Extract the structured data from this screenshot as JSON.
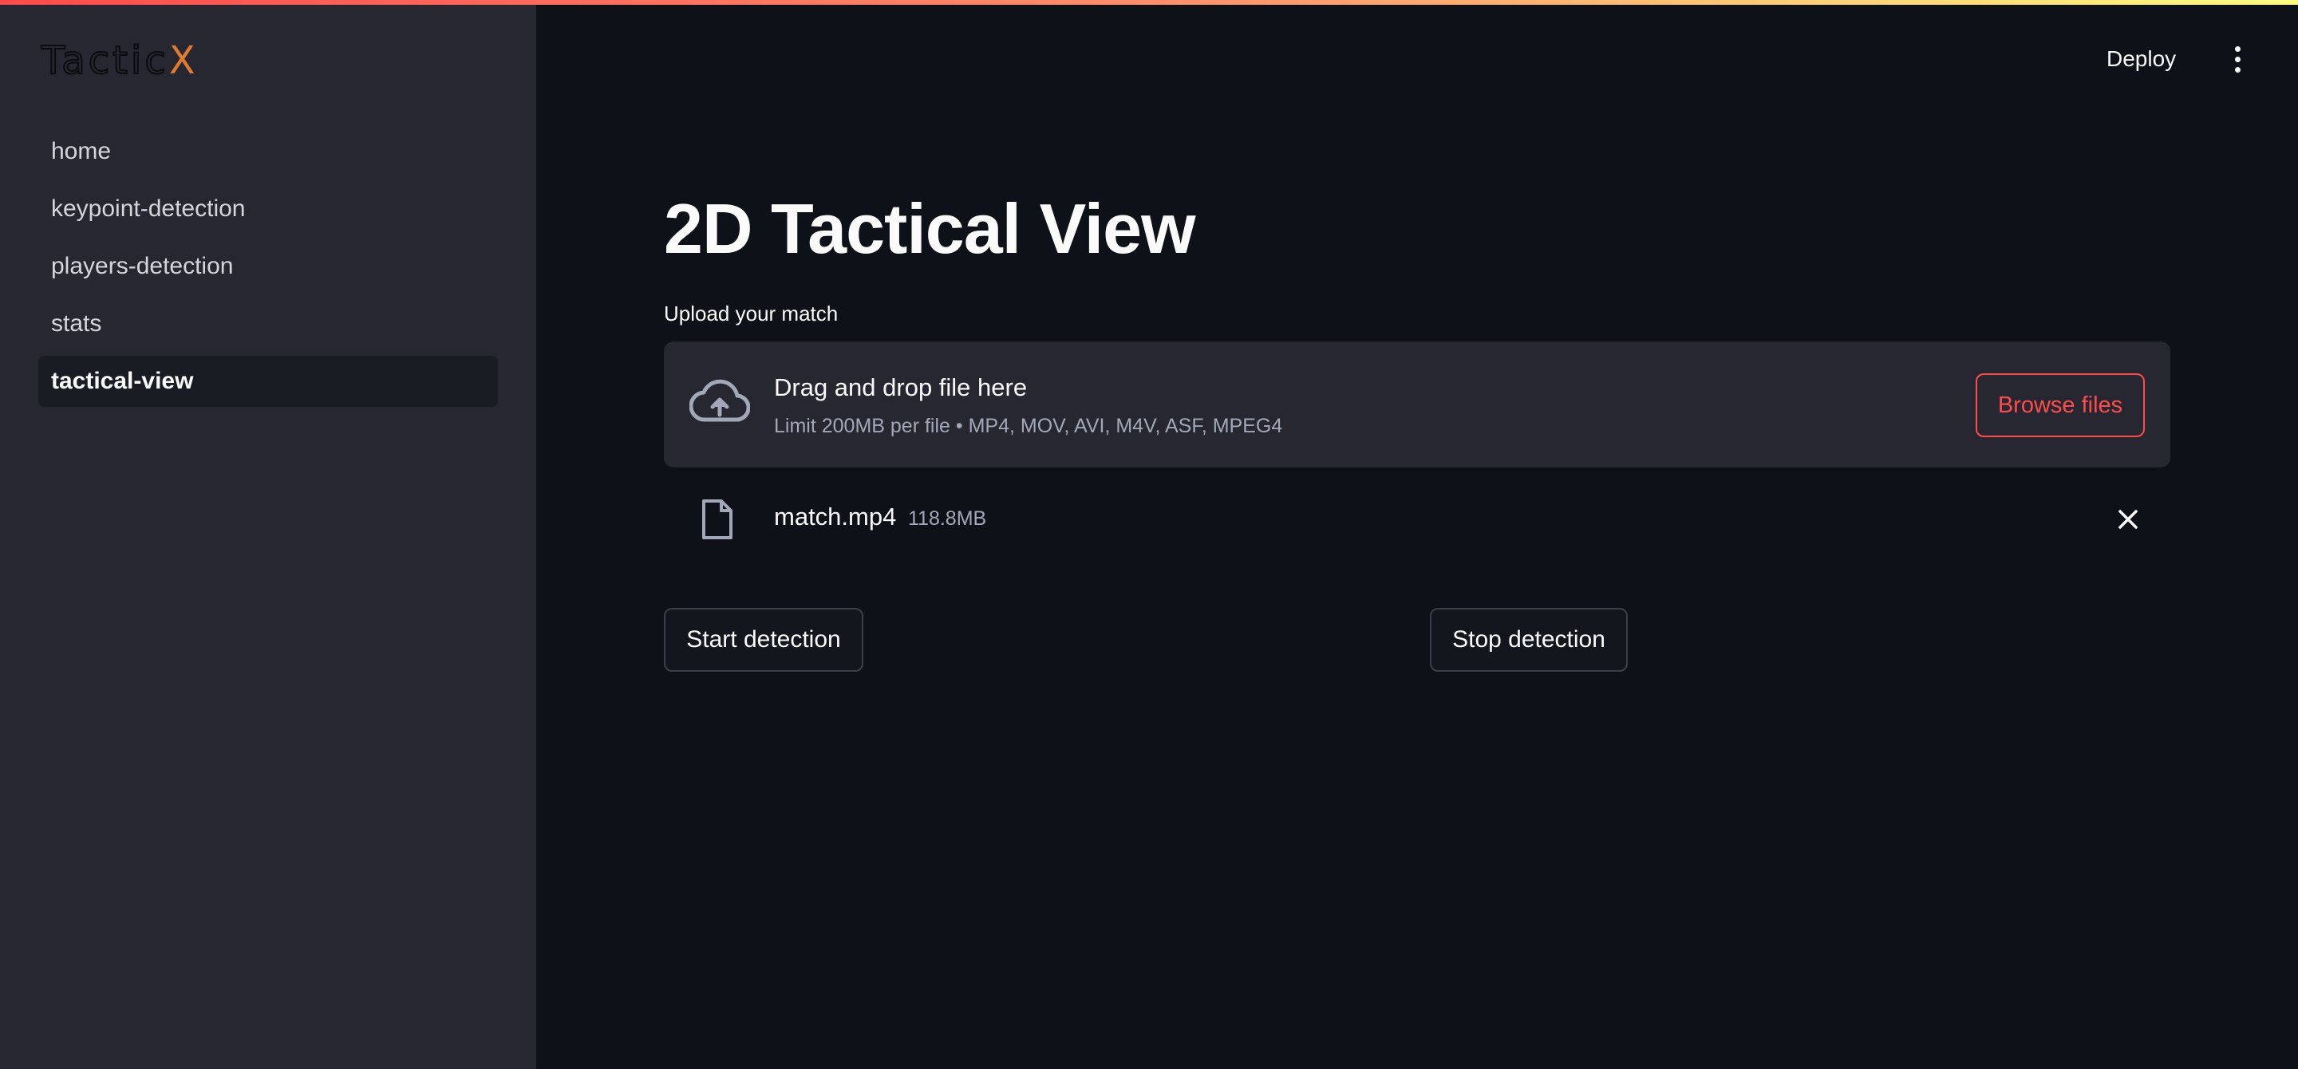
{
  "app": {
    "logo_main": "Tactic",
    "logo_accent": "X",
    "deploy_label": "Deploy"
  },
  "sidebar": {
    "items": [
      {
        "label": "home",
        "active": false
      },
      {
        "label": "keypoint-detection",
        "active": false
      },
      {
        "label": "players-detection",
        "active": false
      },
      {
        "label": "stats",
        "active": false
      },
      {
        "label": "tactical-view",
        "active": true
      }
    ]
  },
  "main": {
    "title": "2D Tactical View",
    "upload": {
      "label": "Upload your match",
      "drop_title": "Drag and drop file here",
      "drop_subtitle": "Limit 200MB per file • MP4, MOV, AVI, M4V, ASF, MPEG4",
      "browse_label": "Browse files"
    },
    "file": {
      "name": "match.mp4",
      "size": "118.8MB"
    },
    "buttons": {
      "start_label": "Start detection",
      "stop_label": "Stop detection"
    }
  },
  "colors": {
    "accent": "#ff4b4b",
    "sidebar_bg": "#262730",
    "main_bg": "#0e1117",
    "logo_accent": "#e07a2e"
  },
  "icons": [
    "cloud-upload-icon",
    "file-icon",
    "close-icon",
    "kebab-menu-icon"
  ]
}
